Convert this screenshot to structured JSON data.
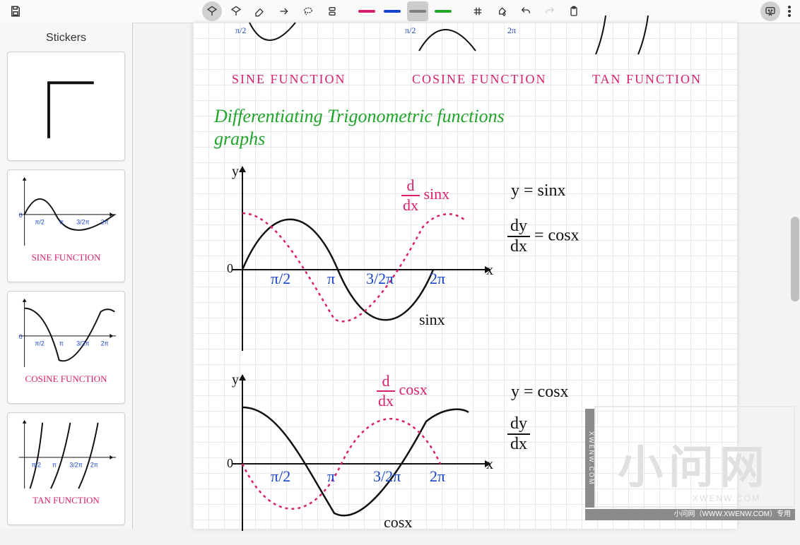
{
  "toolbar": {
    "center_icons": [
      "whiteboard",
      "pen",
      "eraser",
      "arrow",
      "lasso",
      "align"
    ],
    "colors": [
      {
        "name": "red",
        "hex": "#d9206e"
      },
      {
        "name": "blue",
        "hex": "#1444c9"
      },
      {
        "name": "grey",
        "hex": "#808080"
      },
      {
        "name": "green",
        "hex": "#27a52a"
      }
    ],
    "active_color_index": 2,
    "right_icons": [
      "grid",
      "fill",
      "undo",
      "redo",
      "clipboard"
    ]
  },
  "left_panel": {
    "title": "Stickers",
    "items": [
      {
        "kind": "shape",
        "caption": ""
      },
      {
        "kind": "sine",
        "caption": "SINE FUNCTION"
      },
      {
        "kind": "cosine",
        "caption": "COSINE FUNCTION"
      },
      {
        "kind": "tan",
        "caption": "TAN FUNCTION"
      }
    ]
  },
  "canvas": {
    "top_labels": [
      "SINE  FUNCTION",
      "COSINE  FUNCTION",
      "TAN   FUNCTION"
    ],
    "title_line1": "Differentiating  Trigonometric  functions",
    "title_line2": "graphs",
    "graph1": {
      "y_label": "y",
      "x_label": "x",
      "origin": "0",
      "ticks": [
        "π/2",
        "π",
        "3/2π",
        "2π"
      ],
      "deriv_label": "d/dx sinx",
      "curve_label": "sinx",
      "eq1": "y = sinx",
      "eq2a": "dy",
      "eq2b": "dx",
      "eq2c": "=  cosx"
    },
    "graph2": {
      "y_label": "y",
      "x_label": "x",
      "origin": "0",
      "ticks": [
        "π/2",
        "π",
        "3/2π",
        "2π"
      ],
      "deriv_label": "d/dx cosx",
      "curve_label": "cosx",
      "eq1": "y = cosx",
      "eq2a": "dy",
      "eq2b": "dx"
    },
    "watermark": {
      "big": "小问网",
      "side": "XWENW.COM",
      "sub": "XWENW.COM",
      "bar": "小问网（WWW.XWENW.COM）专用"
    }
  }
}
